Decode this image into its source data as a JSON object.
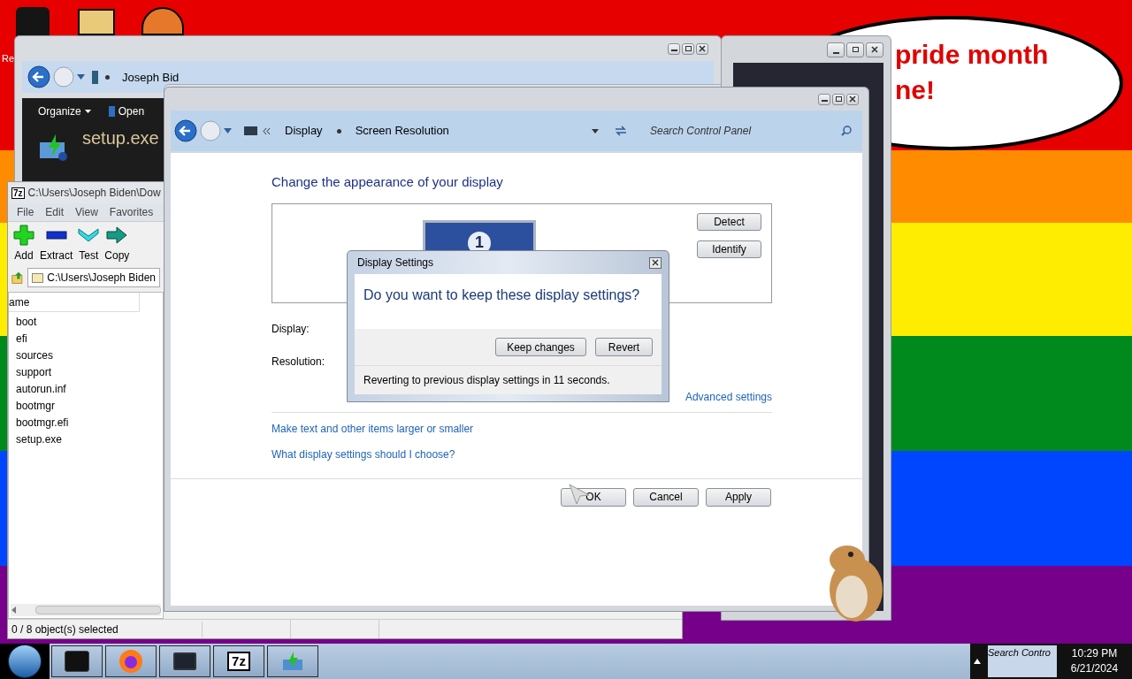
{
  "desktop": {
    "icon_label": "Re",
    "bubble_lines": [
      "pride month",
      "ne!"
    ]
  },
  "explorer": {
    "breadcrumb": "Joseph Bid",
    "toolbar": [
      {
        "label": "Organize",
        "dropdown": true
      },
      {
        "label": "Open",
        "dropdown": false
      }
    ],
    "preview_name": "setup.exe"
  },
  "archiver": {
    "icon_text": "7z",
    "title": "C:\\Users\\Joseph Biden\\Dow",
    "menu": [
      "File",
      "Edit",
      "View",
      "Favorites"
    ],
    "toolbar": [
      {
        "kind": "add",
        "label": "Add"
      },
      {
        "kind": "extract",
        "label": "Extract"
      },
      {
        "kind": "test",
        "label": "Test"
      },
      {
        "kind": "copy",
        "label": "Copy"
      }
    ],
    "path": "C:\\Users\\Joseph Biden",
    "column": "ame",
    "files": [
      "boot",
      "efi",
      "sources",
      "support",
      "autorun.inf",
      "bootmgr",
      "bootmgr.efi",
      "setup.exe"
    ],
    "status": "0 / 8 object(s) selected"
  },
  "control_panel": {
    "breadcrumb": [
      "Display",
      "Screen Resolution"
    ],
    "search": {
      "placeholder": "Search Control Panel"
    },
    "heading": "Change the appearance of your display",
    "monitor_number": "1",
    "side_buttons": [
      "Detect",
      "Identify"
    ],
    "fields": [
      "Display:",
      "Resolution:"
    ],
    "advanced_link": "Advanced settings",
    "links": [
      "Make text and other items larger or smaller",
      "What display settings should I choose?"
    ],
    "buttons": [
      "OK",
      "Cancel",
      "Apply"
    ]
  },
  "dialog": {
    "title": "Display Settings",
    "question": "Do you want to keep these display settings?",
    "buttons": [
      "Keep changes",
      "Revert"
    ],
    "countdown": "Reverting to previous display settings in 11 seconds."
  },
  "taskbar": {
    "items": [
      {
        "kind": "terminal"
      },
      {
        "kind": "browser"
      },
      {
        "kind": "monitor"
      },
      {
        "kind": "archiver",
        "label": "7z"
      },
      {
        "kind": "installer"
      }
    ],
    "tray_preview": "Search Contro",
    "time": "10:29 PM",
    "date": "6/21/2024"
  }
}
